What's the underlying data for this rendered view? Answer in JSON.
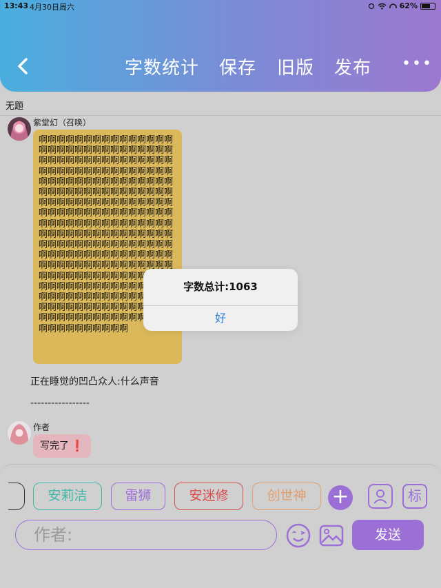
{
  "status": {
    "time": "13:43",
    "date": "4月30日周六",
    "battery": "62%",
    "battery_level": 0.62
  },
  "header": {
    "back_icon": "chevron-left-icon",
    "nav": [
      "字数统计",
      "保存",
      "旧版",
      "发布"
    ],
    "more": "•••"
  },
  "document": {
    "title": "无题"
  },
  "messages": [
    {
      "sender": "紫堂幻（召唤）",
      "text": "啊啊啊啊啊啊啊啊啊啊啊啊啊啊啊啊啊啊啊啊啊啊啊啊啊啊啊啊啊啊啊啊啊啊啊啊啊啊啊啊啊啊啊啊啊啊啊啊啊啊啊啊啊啊啊啊啊啊啊啊啊啊啊啊啊啊啊啊啊啊啊啊啊啊啊啊啊啊啊啊啊啊啊啊啊啊啊啊啊啊啊啊啊啊啊啊啊啊啊啊啊啊啊啊啊啊啊啊啊啊啊啊啊啊啊啊啊啊啊啊啊啊啊啊啊啊啊啊啊啊啊啊啊啊啊啊啊啊啊啊啊啊啊啊啊啊啊啊啊啊啊啊啊啊啊啊啊啊啊啊啊啊啊啊啊啊啊啊啊啊啊啊啊啊啊啊啊啊啊啊啊啊啊啊啊啊啊啊啊啊啊啊啊啊啊啊啊啊啊啊啊啊啊啊啊啊啊啊啊啊啊啊啊啊啊啊啊啊啊啊啊啊啊啊啊啊啊啊啊啊啊啊啊啊啊啊啊啊啊啊啊啊啊啊啊啊啊啊啊啊啊啊啊啊啊啊啊啊啊啊啊啊啊啊啊啊啊啊啊啊啊啊啊啊啊啊啊啊啊啊"
    },
    {
      "narration": "正在睡觉的凹凸众人:什么声音"
    },
    {
      "divider": "-----------------"
    },
    {
      "sender": "作者",
      "text": "写完了",
      "mark": "❗"
    }
  ],
  "toolbar": {
    "characters": [
      {
        "label": "安莉洁",
        "color": "#3fb8a6"
      },
      {
        "label": "雷狮",
        "color": "#9b6fd6"
      },
      {
        "label": "安迷修",
        "color": "#d94c4c"
      },
      {
        "label": "创世神",
        "color": "#e0a070"
      }
    ],
    "plus": "+",
    "tag_label": "标",
    "input_placeholder": "作者:",
    "send_label": "发送"
  },
  "alert": {
    "message": "字数总计:1063",
    "ok_label": "好"
  }
}
